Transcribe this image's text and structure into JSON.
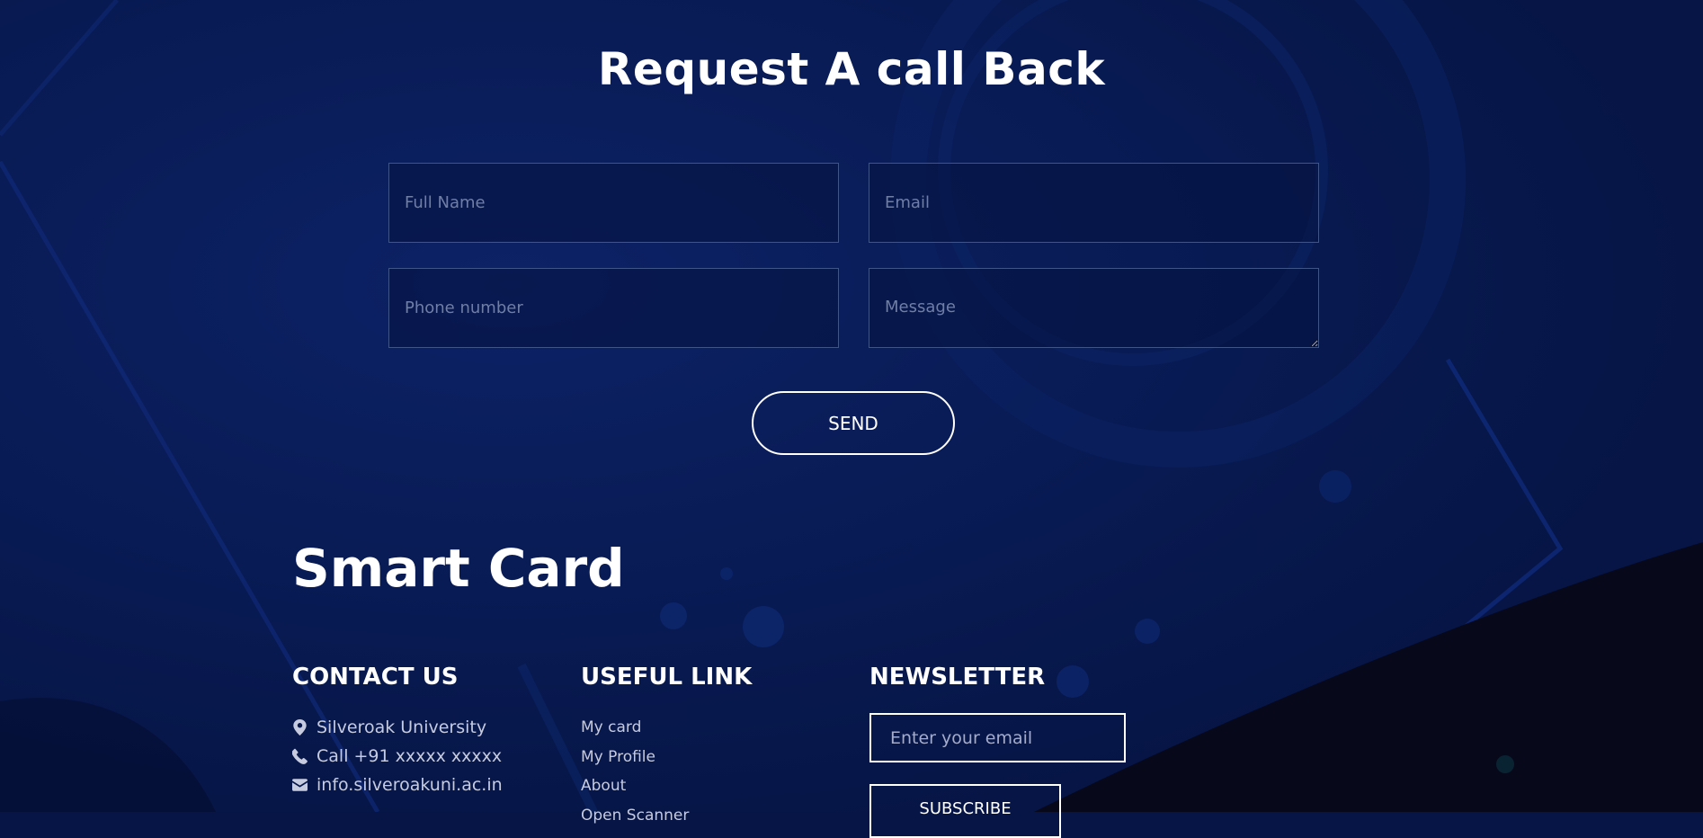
{
  "callback": {
    "title": "Request A call Back",
    "full_name_placeholder": "Full Name",
    "email_placeholder": "Email",
    "phone_placeholder": "Phone number",
    "message_placeholder": "Message",
    "send_label": "SEND"
  },
  "footer": {
    "brand": "Smart Card",
    "contact": {
      "title": "CONTACT US",
      "address": "Silveroak University",
      "phone": "Call +91 xxxxx xxxxx",
      "email": "info.silveroakuni.ac.in"
    },
    "links": {
      "title": "USEFUL LINK",
      "items": [
        "My card",
        "My Profile",
        "About",
        "Open Scanner"
      ]
    },
    "newsletter": {
      "title": "NEWSLETTER",
      "email_placeholder": "Enter your email",
      "subscribe_label": "SUBSCRIBE"
    }
  },
  "icons": {
    "address": "map-pin-icon",
    "phone": "phone-icon",
    "email": "envelope-icon"
  },
  "colors": {
    "background": "#061545",
    "dark_corner": "#07081a",
    "field_border": "#3f5588",
    "link_text": "#c6cbe0"
  }
}
